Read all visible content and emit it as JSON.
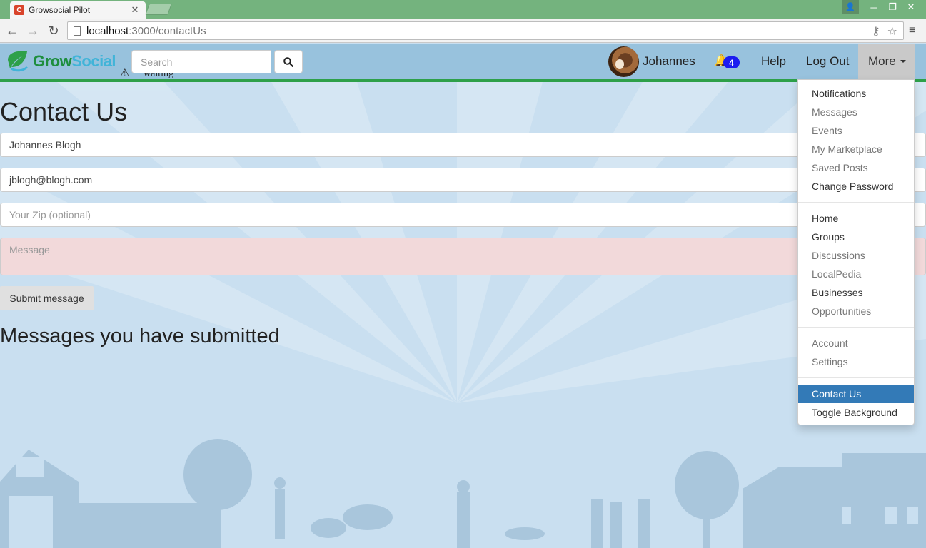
{
  "browser": {
    "tab_title": "Growsocial Pilot",
    "tab_favicon_letter": "C",
    "url_host": "localhost",
    "url_rest": ":3000/contactUs"
  },
  "navbar": {
    "logo_grow": "Grow",
    "logo_social": "Social",
    "status_text": "waiting",
    "search_placeholder": "Search",
    "user_name": "Johannes",
    "notification_count": "4",
    "help_label": "Help",
    "logout_label": "Log Out",
    "more_label": "More"
  },
  "form": {
    "title": "Contact Us",
    "name_value": "Johannes Blogh",
    "email_value": "jblogh@blogh.com",
    "zip_placeholder": "Your Zip (optional)",
    "message_placeholder": "Message",
    "submit_label": "Submit message",
    "submitted_title": "Messages you have submitted"
  },
  "dropdown": {
    "items": [
      {
        "label": "Notifications"
      },
      {
        "label": "Messages"
      },
      {
        "label": "Events"
      },
      {
        "label": "My Marketplace"
      },
      {
        "label": "Saved Posts"
      },
      {
        "label": "Change Password"
      },
      {
        "label": "Home"
      },
      {
        "label": "Groups"
      },
      {
        "label": "Discussions"
      },
      {
        "label": "LocalPedia"
      },
      {
        "label": "Businesses"
      },
      {
        "label": "Opportunities"
      },
      {
        "label": "Account"
      },
      {
        "label": "Settings"
      },
      {
        "label": "Contact Us"
      },
      {
        "label": "Toggle Background"
      }
    ]
  },
  "colors": {
    "tabstrip": "#74b37e",
    "navbar": "#98c2dd",
    "accent": "#2ea049",
    "active_item": "#337ab7",
    "badge": "#1c1cf0"
  }
}
